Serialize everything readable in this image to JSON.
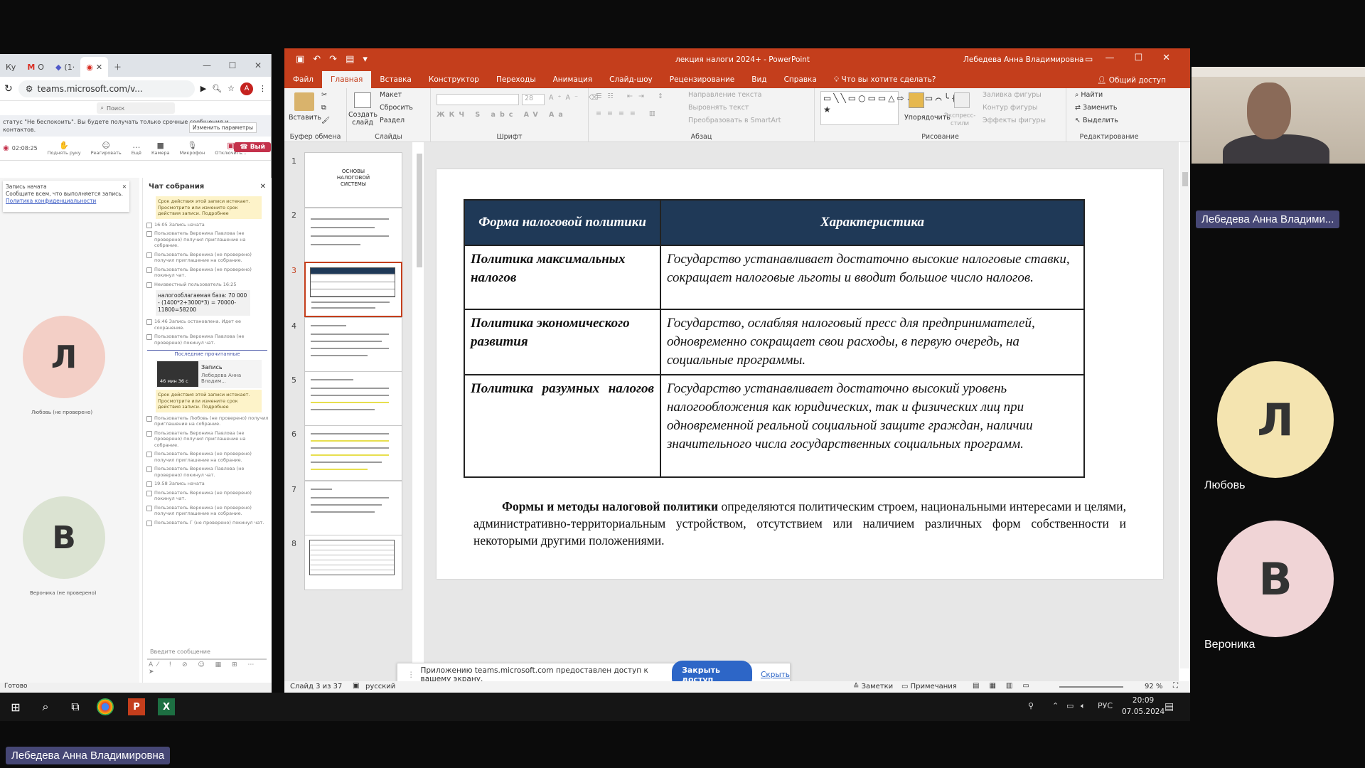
{
  "chrome": {
    "tabs": [
      "Ку",
      "О",
      "(1·",
      ""
    ],
    "url": "teams.microsoft.com/v...",
    "profile_letter": "A",
    "status_text": "Готово"
  },
  "teams": {
    "search_placeholder": "Поиск",
    "status_banner": "статус \"Не беспокоить\". Вы будете получать только срочные сообщения и... контактов.",
    "status_button": "Изменить параметры",
    "timer": "02:08:25",
    "toolbar": [
      "Поднять руку",
      "Реагировать",
      "Ещё",
      "Камера",
      "Микрофон",
      "Отключить..."
    ],
    "leave_label": "Вый",
    "recording_card": {
      "title": "Запись начата",
      "text": "Сообщите всем, что выполняется запись.",
      "link": "Политика конфиденциальности"
    },
    "left_participants": [
      {
        "initial": "Л",
        "name": "Любовь (не проверено)"
      },
      {
        "initial": "В",
        "name": "Вероника (не проверено)"
      }
    ],
    "chat": {
      "title": "Чат собрания",
      "card1": "Срок действия этой записи истекает. Просмотрите или измените срок действия записи. Подробнее",
      "line1": "16:05  Запись начата",
      "line2": "Пользователь Вероника Павлова (не проверено) получил приглашение на собрание.",
      "line3": "Пользователь Вероника (не проверено) получил приглашение на собрание.",
      "line4": "Пользователь Вероника (не проверено) покинул чат.",
      "msg_author": "Неизвестный пользователь  16:25",
      "msg_text": "налогооблагаемая база: 70 000 - (1400*2+3000*3) = 70000-11800=58200",
      "line5": "16:46  Запись остановлена. Идет ее сохранение.",
      "line6": "Пользователь Вероника Павлова (не проверено) покинул чат.",
      "last_read": "Последние прочитанные",
      "rec_title": "Запись",
      "rec_author": "Лебедева Анна Владим...",
      "rec_duration": "46 мин 36 с",
      "card2": "Срок действия этой записи истекает. Просмотрите или измените срок действия записи. Подробнее",
      "line7": "Пользователь Любовь (не проверено) получил приглашение на собрание.",
      "line8": "Пользователь Вероника Павлова (не проверено) получил приглашение на собрание.",
      "line9": "Пользователь Вероника (не проверено) получил приглашение на собрание.",
      "line10": "Пользователь Вероника Павлова (не проверено) покинул чат.",
      "line11": "19:58  Запись начата",
      "line12": "Пользователь Вероника (не проверено) покинул чат.",
      "line13": "Пользователь Вероника (не проверено) получил приглашение на собрание.",
      "line14": "Пользователь Г (не проверено) покинул чат.",
      "input_placeholder": "Введите сообщение"
    }
  },
  "ppt": {
    "doc_title": "лекция налоги 2024+  -  PowerPoint",
    "user": "Лебедева Анна Владимировна",
    "tabs": [
      "Файл",
      "Главная",
      "Вставка",
      "Конструктор",
      "Переходы",
      "Анимация",
      "Слайд-шоу",
      "Рецензирование",
      "Вид",
      "Справка"
    ],
    "tell_me": "Что вы хотите сделать?",
    "share": "Общий доступ",
    "ribbon": {
      "paste": "Вставить",
      "clipboard": "Буфер обмена",
      "new_slide": "Создать слайд",
      "layout": "Макет",
      "reset": "Сбросить",
      "section": "Раздел",
      "slides": "Слайды",
      "font": "Шрифт",
      "font_size": "28",
      "text_direction": "Направление текста",
      "align_text": "Выровнять текст",
      "smartart": "Преобразовать в SmartArt",
      "paragraph": "Абзац",
      "arrange": "Упорядочить",
      "quick_styles": "Экспресс-стили",
      "fill": "Заливка фигуры",
      "outline": "Контур фигуры",
      "effects": "Эффекты фигуры",
      "drawing": "Рисование",
      "find": "Найти",
      "replace": "Заменить",
      "select": "Выделить",
      "editing": "Редактирование"
    },
    "thumb1_title": "ОСНОВЫ НАЛОГОВОЙ СИСТЕМЫ",
    "slide_numbers": [
      "1",
      "2",
      "3",
      "4",
      "5",
      "6",
      "7",
      "8"
    ],
    "table": {
      "headers": [
        "Форма налоговой политики",
        "Характеристика"
      ],
      "rows": [
        {
          "form": "Политика максимальных налогов",
          "desc": "Государство устанавливает достаточно высокие налоговые ставки, сокращает налоговые льготы и вводит большое число налогов."
        },
        {
          "form": "Политика экономического развития",
          "desc": "Государство, ослабляя налоговый пресс для предпринимателей, одновременно сокращает свои расходы, в первую очередь, на социальные программы."
        },
        {
          "form": "Политика разумных налогов",
          "desc": "Государство устанавливает достаточно высокий уровень налогообложения как юридических, так и физических лиц при одновременной реальной социальной защите граждан, наличии значительного числа государственных социальных программ."
        }
      ]
    },
    "paragraph_bold": "Формы и методы налоговой политики",
    "paragraph_rest": " определяются политическим строем, национальными интересами и целями, административно-территориальным устройством, отсутствием или наличием различных форм собственности и некоторыми другими положениями.",
    "share_bar": {
      "text": "Приложению teams.microsoft.com предоставлен доступ к вашему экрану.",
      "stop": "Закрыть доступ",
      "hide": "Скрыть"
    },
    "status": {
      "slide": "Слайд 3 из 37",
      "language": "русский",
      "notes": "Заметки",
      "comments": "Примечания",
      "zoom": "92 %"
    }
  },
  "right_panel": {
    "presenter_badge": "Лебедева Анна Владими...",
    "participants": [
      {
        "initial": "Л",
        "name": "Любовь",
        "color": "#f4e4b0"
      },
      {
        "initial": "В",
        "name": "Вероника",
        "color": "#f0d4d6"
      }
    ]
  },
  "taskbar": {
    "lang": "РУС",
    "time": "20:09",
    "date": "07.05.2024"
  },
  "bottom_badge": "Лебедева Анна Владимировна",
  "colors": {
    "ppt_accent": "#c43e1c",
    "table_header": "#1f3957",
    "teams_purple": "#464775"
  }
}
